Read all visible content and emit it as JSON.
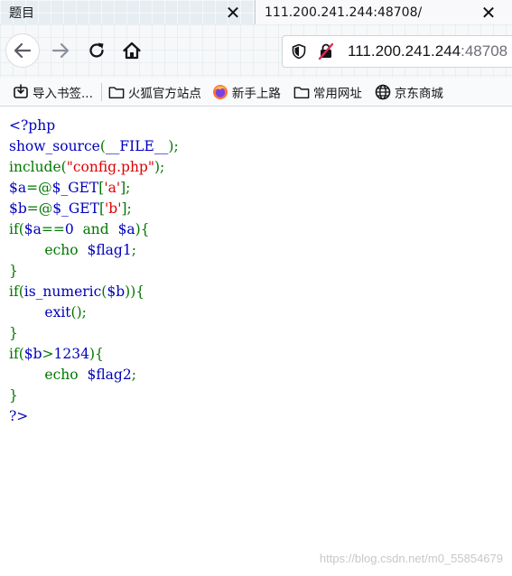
{
  "tabs": [
    {
      "title": "题目",
      "close": "✕"
    },
    {
      "title": "111.200.241.244:48708/",
      "close": "✕"
    }
  ],
  "nav": {
    "url_host": "111.200.241.244",
    "url_rest": ":48708"
  },
  "bookmarks": [
    {
      "label": "导入书签...",
      "icon": "import-icon"
    },
    {
      "label": "火狐官方站点",
      "icon": "folder-icon"
    },
    {
      "label": "新手上路",
      "icon": "firefox-icon"
    },
    {
      "label": "常用网址",
      "icon": "folder-icon"
    },
    {
      "label": "京东商城",
      "icon": "globe-icon"
    }
  ],
  "code_lines": [
    [
      {
        "t": "<?php",
        "c": "blue"
      }
    ],
    [
      {
        "t": "show_source",
        "c": "blue"
      },
      {
        "t": "(",
        "c": "green"
      },
      {
        "t": "__FILE__",
        "c": "blue"
      },
      {
        "t": ");",
        "c": "green"
      }
    ],
    [
      {
        "t": "include(",
        "c": "green"
      },
      {
        "t": "\"config.php\"",
        "c": "red"
      },
      {
        "t": ");",
        "c": "green"
      }
    ],
    [
      {
        "t": "$a",
        "c": "blue"
      },
      {
        "t": "=@",
        "c": "green"
      },
      {
        "t": "$_GET",
        "c": "blue"
      },
      {
        "t": "[",
        "c": "green"
      },
      {
        "t": "'a'",
        "c": "red"
      },
      {
        "t": "];",
        "c": "green"
      }
    ],
    [
      {
        "t": "$b",
        "c": "blue"
      },
      {
        "t": "=@",
        "c": "green"
      },
      {
        "t": "$_GET",
        "c": "blue"
      },
      {
        "t": "[",
        "c": "green"
      },
      {
        "t": "'b'",
        "c": "red"
      },
      {
        "t": "];",
        "c": "green"
      }
    ],
    [
      {
        "t": "if(",
        "c": "green"
      },
      {
        "t": "$a",
        "c": "blue"
      },
      {
        "t": "==",
        "c": "green"
      },
      {
        "t": "0  ",
        "c": "blue"
      },
      {
        "t": "and  ",
        "c": "green"
      },
      {
        "t": "$a",
        "c": "blue"
      },
      {
        "t": "){",
        "c": "green"
      }
    ],
    [
      {
        "t": "        echo  ",
        "c": "green"
      },
      {
        "t": "$flag1",
        "c": "blue"
      },
      {
        "t": ";",
        "c": "green"
      }
    ],
    [
      {
        "t": "}",
        "c": "green"
      }
    ],
    [
      {
        "t": "if(",
        "c": "green"
      },
      {
        "t": "is_numeric",
        "c": "blue"
      },
      {
        "t": "(",
        "c": "green"
      },
      {
        "t": "$b",
        "c": "blue"
      },
      {
        "t": ")){",
        "c": "green"
      }
    ],
    [
      {
        "t": "        exit",
        "c": "blue"
      },
      {
        "t": "();",
        "c": "green"
      }
    ],
    [
      {
        "t": "}",
        "c": "green"
      }
    ],
    [
      {
        "t": "if(",
        "c": "green"
      },
      {
        "t": "$b",
        "c": "blue"
      },
      {
        "t": ">",
        "c": "green"
      },
      {
        "t": "1234",
        "c": "blue"
      },
      {
        "t": "){",
        "c": "green"
      }
    ],
    [
      {
        "t": "        echo  ",
        "c": "green"
      },
      {
        "t": "$flag2",
        "c": "blue"
      },
      {
        "t": ";",
        "c": "green"
      }
    ],
    [
      {
        "t": "}",
        "c": "green"
      }
    ],
    [
      {
        "t": "?>",
        "c": "blue"
      }
    ]
  ],
  "watermark": "https://blog.csdn.net/m0_55854679"
}
